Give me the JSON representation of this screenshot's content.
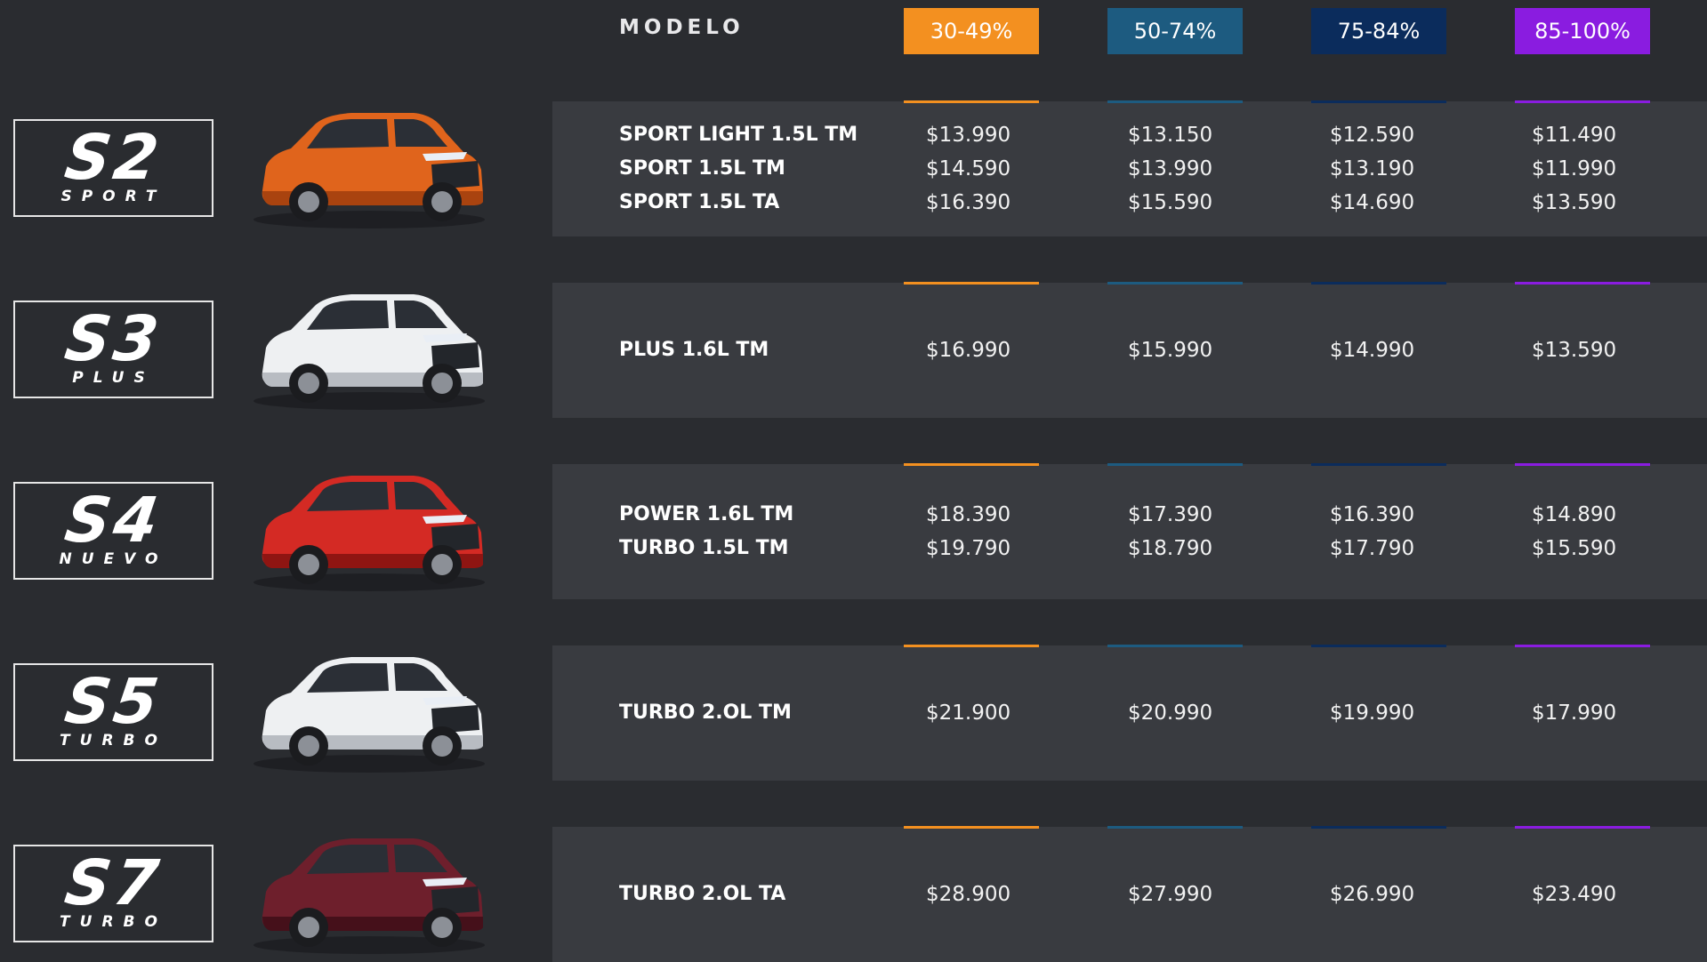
{
  "header": {
    "modelo_label": "MODELO",
    "tiers": [
      {
        "label": "30-49%",
        "color": "#f39020"
      },
      {
        "label": "50-74%",
        "color": "#1d5b80"
      },
      {
        "label": "75-84%",
        "color": "#0b2c5c"
      },
      {
        "label": "85-100%",
        "color": "#8a1ce0"
      }
    ]
  },
  "rows": [
    {
      "badge": {
        "main": "S2",
        "sub": "SPORT"
      },
      "car_color": "orange",
      "models": [
        "SPORT LIGHT 1.5L TM",
        "SPORT 1.5L TM",
        "SPORT 1.5L TA"
      ],
      "prices": [
        [
          "$13.990",
          "$14.590",
          "$16.390"
        ],
        [
          "$13.150",
          "$13.990",
          "$15.590"
        ],
        [
          "$12.590",
          "$13.190",
          "$14.690"
        ],
        [
          "$11.490",
          "$11.990",
          "$13.590"
        ]
      ]
    },
    {
      "badge": {
        "main": "S3",
        "sub": "PLUS"
      },
      "car_color": "white",
      "models": [
        "PLUS 1.6L TM"
      ],
      "prices": [
        [
          "$16.990"
        ],
        [
          "$15.990"
        ],
        [
          "$14.990"
        ],
        [
          "$13.590"
        ]
      ]
    },
    {
      "badge": {
        "main": "S4",
        "sub": "NUEVO"
      },
      "car_color": "red",
      "models": [
        "POWER 1.6L TM",
        "TURBO 1.5L TM"
      ],
      "prices": [
        [
          "$18.390",
          "$19.790"
        ],
        [
          "$17.390",
          "$18.790"
        ],
        [
          "$16.390",
          "$17.790"
        ],
        [
          "$14.890",
          "$15.590"
        ]
      ]
    },
    {
      "badge": {
        "main": "S5",
        "sub": "TURBO"
      },
      "car_color": "white",
      "models": [
        "TURBO 2.OL TM"
      ],
      "prices": [
        [
          "$21.900"
        ],
        [
          "$20.990"
        ],
        [
          "$19.990"
        ],
        [
          "$17.990"
        ]
      ]
    },
    {
      "badge": {
        "main": "S7",
        "sub": "TURBO"
      },
      "car_color": "maroon",
      "models": [
        "TURBO 2.OL TA"
      ],
      "prices": [
        [
          "$28.900"
        ],
        [
          "$27.990"
        ],
        [
          "$26.990"
        ],
        [
          "$23.490"
        ]
      ]
    }
  ]
}
